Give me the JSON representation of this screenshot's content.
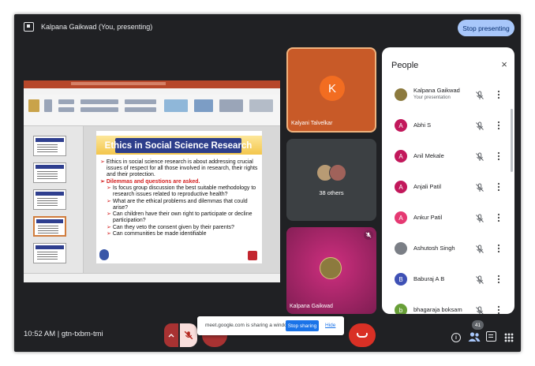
{
  "topbar": {
    "presenting_label": "Kalpana Gaikwad (You, presenting)",
    "stop_presenting_label": "Stop presenting"
  },
  "slide": {
    "title": "Ethics in Social Science Research",
    "lines": [
      {
        "level": 1,
        "bullet": "➢",
        "text": "Ethics in social science research is about addressing crucial issues of respect for all those involved in research, their rights and their protection."
      },
      {
        "level": 1,
        "bullet": "➢",
        "text": "Dilemmas and questions are asked.",
        "style": "red"
      },
      {
        "level": 2,
        "bullet": "➢",
        "text": "Is focus group discussion the best suitable methodology to research issues related to reproductive health?"
      },
      {
        "level": 2,
        "bullet": "➢",
        "text": "What are the ethical problems and dilemmas that could arise?"
      },
      {
        "level": 2,
        "bullet": "➢",
        "text": "Can children have their own right to participate or decline participation?"
      },
      {
        "level": 2,
        "bullet": "➢",
        "text": "Can they veto the consent given by their parents?"
      },
      {
        "level": 2,
        "bullet": "➢",
        "text": "Can communities be made identifiable"
      }
    ]
  },
  "tiles": {
    "kalyani": {
      "initial": "K",
      "name": "Kalyani Talvelkar"
    },
    "others": {
      "label": "38 others"
    },
    "kalpana": {
      "name": "Kalpana Gaikwad"
    }
  },
  "people_panel": {
    "title": "People",
    "close_icon": "×",
    "participants": [
      {
        "name": "Kalpana Gaikwad",
        "sub": "Your presentation",
        "initial": "",
        "color": "#8c7a3e",
        "photo": true
      },
      {
        "name": "Abhi S",
        "initial": "A",
        "color": "#c2185b"
      },
      {
        "name": "Anil Mekale",
        "initial": "A",
        "color": "#c2185b"
      },
      {
        "name": "Anjali Patil",
        "initial": "A",
        "color": "#c2185b"
      },
      {
        "name": "Ankur Patil",
        "initial": "A",
        "color": "#e53972"
      },
      {
        "name": "Ashutosh Singh",
        "initial": "",
        "color": "#7b7f86",
        "photo": true
      },
      {
        "name": "Baburaj A B",
        "initial": "B",
        "color": "#3f51b5"
      },
      {
        "name": "bhagaraja boksam",
        "initial": "b",
        "color": "#689f38"
      }
    ]
  },
  "bottom": {
    "time_code": "10:52 AM  |  gtn-txbm-tmi",
    "people_count": "41",
    "info_glyph": "i"
  },
  "share_toast": {
    "message": "meet.google.com is sharing a window.",
    "stop_sharing_label": "Stop sharing",
    "hide_label": "Hide"
  },
  "colors": {
    "background": "#202124",
    "accent": "#a8c7fa",
    "end_call": "#d93025"
  }
}
